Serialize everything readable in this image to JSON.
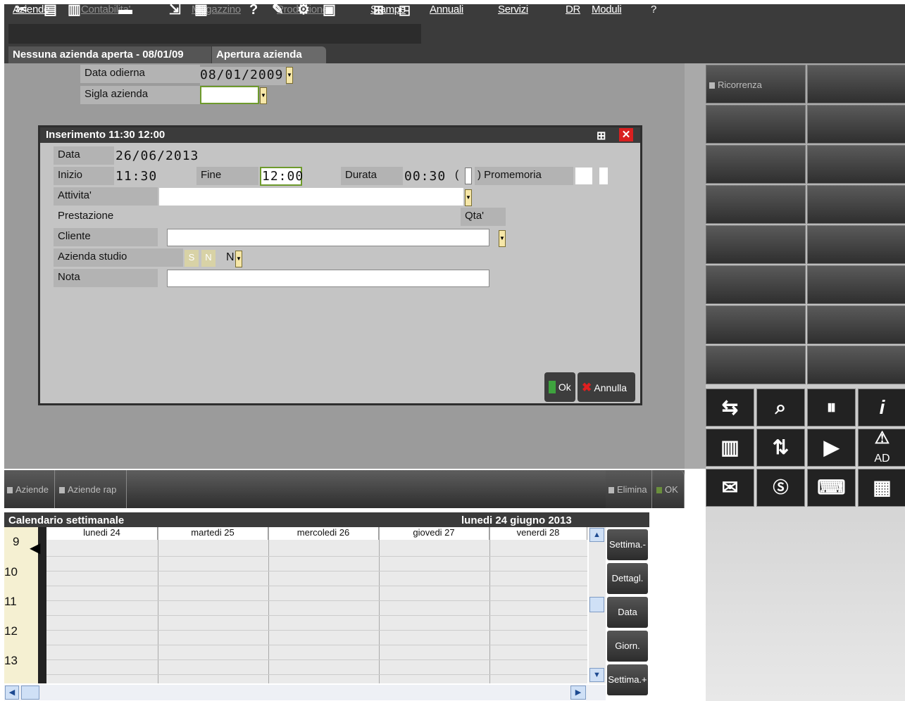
{
  "menu": {
    "items": [
      {
        "label": "Aziende",
        "enabled": true
      },
      {
        "label": "Contabilita'",
        "enabled": false
      },
      {
        "label": "Magazzino",
        "enabled": false
      },
      {
        "label": "Produzione",
        "enabled": false
      },
      {
        "label": "Stampe",
        "enabled": true
      },
      {
        "label": "Annuali",
        "enabled": true
      },
      {
        "label": "Servizi",
        "enabled": true
      },
      {
        "label": "DR",
        "enabled": true
      },
      {
        "label": "Moduli",
        "enabled": true
      },
      {
        "label": "?",
        "enabled": true
      }
    ]
  },
  "tabs": {
    "status": "Nessuna azienda aperta - 08/01/09",
    "current": "Apertura azienda"
  },
  "form": {
    "data_odierna_label": "Data odierna",
    "data_odierna_value": "08/01/2009",
    "sigla_label": "Sigla azienda",
    "sigla_value": ""
  },
  "dialog": {
    "title": "Inserimento 11:30 12:00",
    "data_label": "Data",
    "data_value": "26/06/2013",
    "inizio_label": "Inizio",
    "inizio_value": "11:30",
    "fine_label": "Fine",
    "fine_value": "12:00",
    "durata_label": "Durata",
    "durata_value": "00:30",
    "promemoria_paren_open": "(",
    "promemoria_label": ") Promemoria",
    "attivita_label": "Attivita'",
    "attivita_value": "",
    "prestazione_label": "Prestazione",
    "qta_label": "Qta'",
    "cliente_label": "Cliente",
    "cliente_value": "",
    "azienda_studio_label": "Azienda studio",
    "azienda_s": "S",
    "azienda_n": "N",
    "azienda_value": "N",
    "nota_label": "Nota",
    "nota_value": "",
    "ok_label": "Ok",
    "annulla_label": "Annulla"
  },
  "right_panel": {
    "ricorrenza_label": "Ricorrenza",
    "icon_ad": "AD"
  },
  "bottom_bar": {
    "aziende_label": "Aziende",
    "aziende_rap_label": "Aziende rap",
    "elimina_label": "Elimina",
    "ok_label": "OK"
  },
  "calendar": {
    "title": "Calendario settimanale",
    "current_date": "lunedi 24 giugno 2013",
    "days": [
      "lunedi 24",
      "martedi 25",
      "mercoledi 26",
      "giovedi 27",
      "venerdi 28"
    ],
    "hours": [
      "9",
      "10",
      "11",
      "12",
      "13"
    ],
    "side_buttons": [
      "Settima.-",
      "Dettagl.",
      "Data",
      "Giorn.",
      "Settima.+"
    ]
  }
}
